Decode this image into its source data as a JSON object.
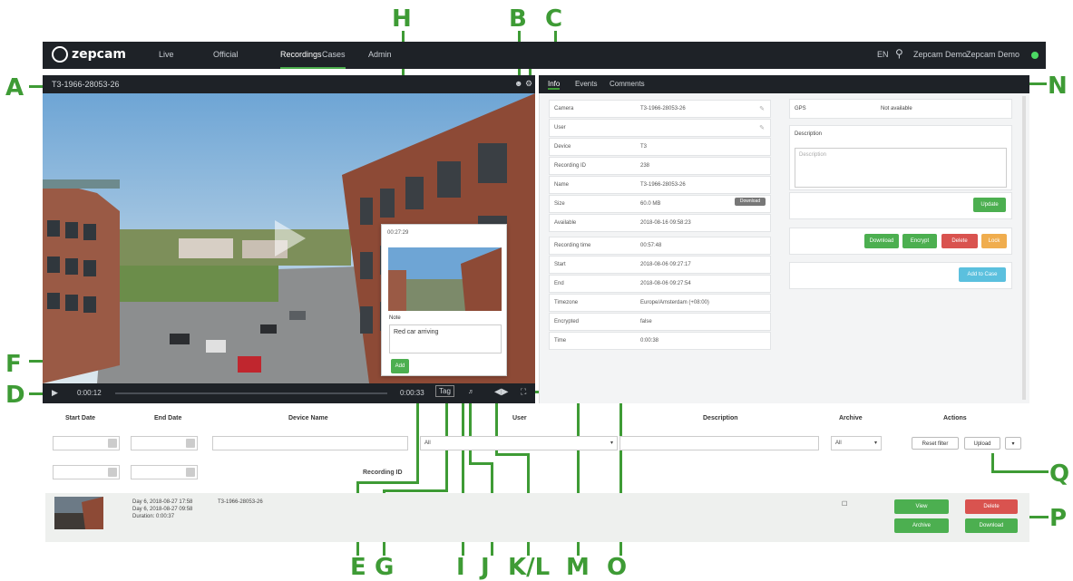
{
  "callouts": [
    "A",
    "B",
    "C",
    "D",
    "E",
    "F",
    "G",
    "H",
    "I",
    "J",
    "K/L",
    "M",
    "N",
    "O",
    "P",
    "Q"
  ],
  "nav": {
    "brand": "zepcam",
    "items": [
      "Live",
      "Official",
      "Recordings",
      "Cases",
      "Admin"
    ],
    "active": "Recordings",
    "right": [
      "EN",
      "Zepcam Demo",
      "Zepcam Demo"
    ]
  },
  "video": {
    "title": "T3-1966-28053-26",
    "time_current": "0:00:12",
    "time_total": "0:00:33",
    "tag_label": "Tag"
  },
  "tabs": [
    "Info",
    "Events",
    "Comments"
  ],
  "info_rows": [
    {
      "k": "Camera",
      "v": "T3-1966-28053-26"
    },
    {
      "k": "User",
      "v": ""
    },
    {
      "k": "Device",
      "v": "T3"
    },
    {
      "k": "Recording ID",
      "v": "238"
    },
    {
      "k": "Name",
      "v": "T3-1966-28053-26"
    },
    {
      "k": "Size",
      "v": "60.0 MB"
    },
    {
      "k": "Available",
      "v": "2018-08-16 09:58:23"
    },
    {
      "k": "Recording time",
      "v": "00:57:48"
    },
    {
      "k": "Start",
      "v": "2018-08-06 09:27:17"
    },
    {
      "k": "End",
      "v": "2018-08-06 09:27:54"
    },
    {
      "k": "Timezone",
      "v": "Europe/Amsterdam (+08:00)"
    },
    {
      "k": "Encrypted",
      "v": "false"
    },
    {
      "k": "Time",
      "v": "0:00:38"
    }
  ],
  "size_badge": "Download",
  "right_panel": {
    "gps_label": "GPS",
    "gps_value": "Not available",
    "description_label": "Description",
    "description_placeholder": "Description",
    "update_btn": "Update",
    "download_btn": "Download",
    "edit_btn": "Encrypt",
    "delete_btn": "Delete",
    "lock_btn": "Lock",
    "add_case_btn": "Add to Case"
  },
  "popup": {
    "time": "00:27:29",
    "note_label": "Note",
    "note_value": "Red car arriving",
    "add_btn": "Add"
  },
  "table": {
    "headers": [
      "Start Date",
      "End Date",
      "Device Name",
      "User",
      "Description",
      "Archive",
      "Actions"
    ],
    "archive_value": "All",
    "user_value": "All",
    "reset_btn": "Reset filter",
    "upload_btn": "Upload",
    "recording_id_label": "Recording ID",
    "row": {
      "lines": [
        "Day 6, 2018-08-27 17:58",
        "Day 6, 2018-08-27 09:58",
        "Duration: 0:00:37"
      ],
      "name": "T3-1966-28053-26",
      "view_btn": "View",
      "edit_btn": "Archive",
      "delete_btn": "Delete",
      "download_btn": "Download"
    }
  }
}
